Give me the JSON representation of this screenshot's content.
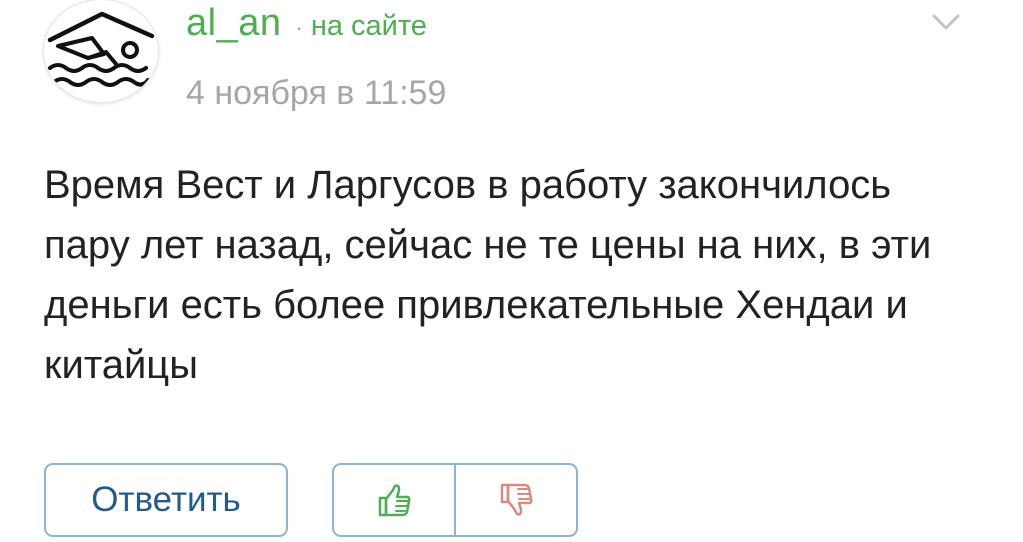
{
  "comment": {
    "author": {
      "username": "al_an",
      "separator": "·",
      "status": "на сайте",
      "avatar_icon": "swimmer-icon"
    },
    "timestamp": "4 ноября в 11:59",
    "text": "Время Вест и Ларгусов в работу закончилось пару лет назад, сейчас не те цены на них, в эти деньги есть более привлекательные Хендаи и китайцы",
    "menu_icon": "chevron-down-icon",
    "actions": {
      "reply_label": "Ответить",
      "like_icon": "thumbs-up-icon",
      "dislike_icon": "thumbs-down-icon"
    }
  },
  "colors": {
    "username": "#4caf50",
    "status": "#4caf50",
    "timestamp": "#a6a6a6",
    "text": "#222222",
    "button_border": "#8bb3d6",
    "reply_text": "#235b8f",
    "like_icon": "#4caf50",
    "dislike_icon": "#d98a80"
  }
}
